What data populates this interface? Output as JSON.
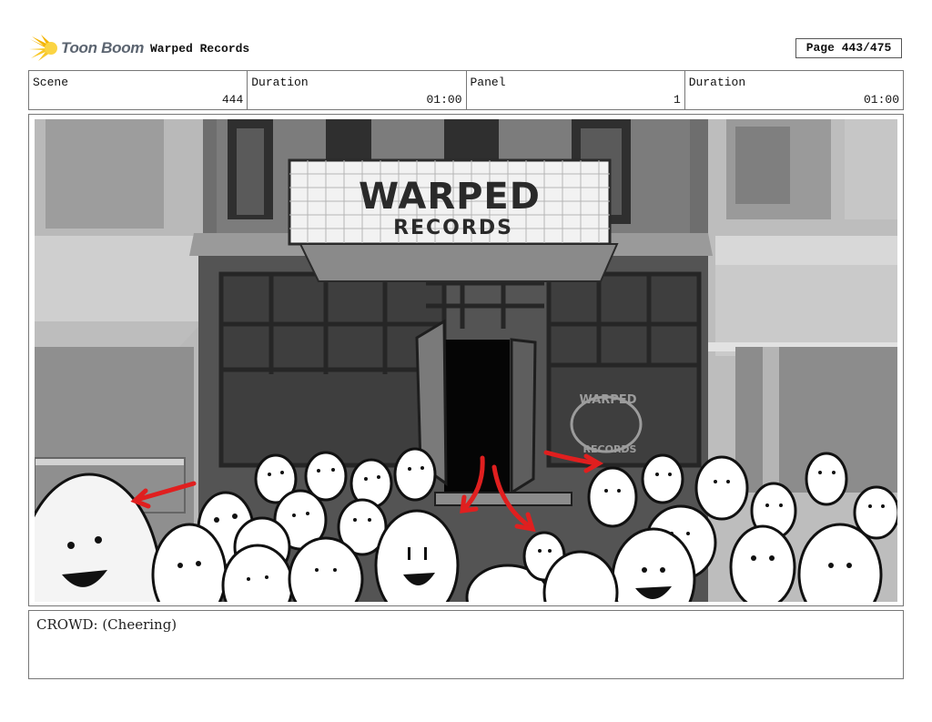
{
  "header": {
    "brand": "Toon Boom",
    "project_title": "Warped Records",
    "page_label": "Page 443/475"
  },
  "info": {
    "scene_label": "Scene",
    "scene_value": "444",
    "duration1_label": "Duration",
    "duration1_value": "01:00",
    "panel_label": "Panel",
    "panel_value": "1",
    "duration2_label": "Duration",
    "duration2_value": "01:00"
  },
  "artwork": {
    "sign_line1": "WARPED",
    "sign_line2": "RECORDS",
    "window_line1": "WARPED",
    "window_line2": "RECORDS",
    "arrow_color": "#e01f1f"
  },
  "notes": {
    "dialogue": "CROWD: (Cheering)"
  }
}
